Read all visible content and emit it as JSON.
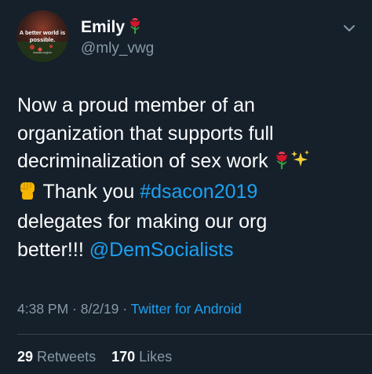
{
  "user": {
    "display_name": "Emily",
    "handle": "@mly_vwg",
    "avatar": {
      "text": "A better world is possible.",
      "url": "dsausa.org/join"
    }
  },
  "tweet": {
    "lines": [
      {
        "text": "Now a proud member of an"
      },
      {
        "text": "organization that supports full"
      },
      {
        "text": "decriminalization of sex work"
      },
      {
        "before": "Thank you ",
        "hashtag": "#dsacon2019"
      },
      {
        "text": "delegates for making our org"
      },
      {
        "before": "better!!! ",
        "mention": "@DemSocialists"
      }
    ],
    "emoji": [
      "rose-icon",
      "sparkles-icon",
      "raised-fist-icon"
    ]
  },
  "meta": {
    "time": "4:38 PM",
    "separator1": " · ",
    "date": "8/2/19",
    "separator2": " · ",
    "source": "Twitter for Android"
  },
  "stats": {
    "retweets_count": "29",
    "retweets_label": "Retweets",
    "likes_count": "170",
    "likes_label": "Likes"
  },
  "colors": {
    "background": "#15202b",
    "text": "#ffffff",
    "secondary": "#8899a6",
    "accent": "#1da1f2",
    "divider": "#38444d"
  }
}
